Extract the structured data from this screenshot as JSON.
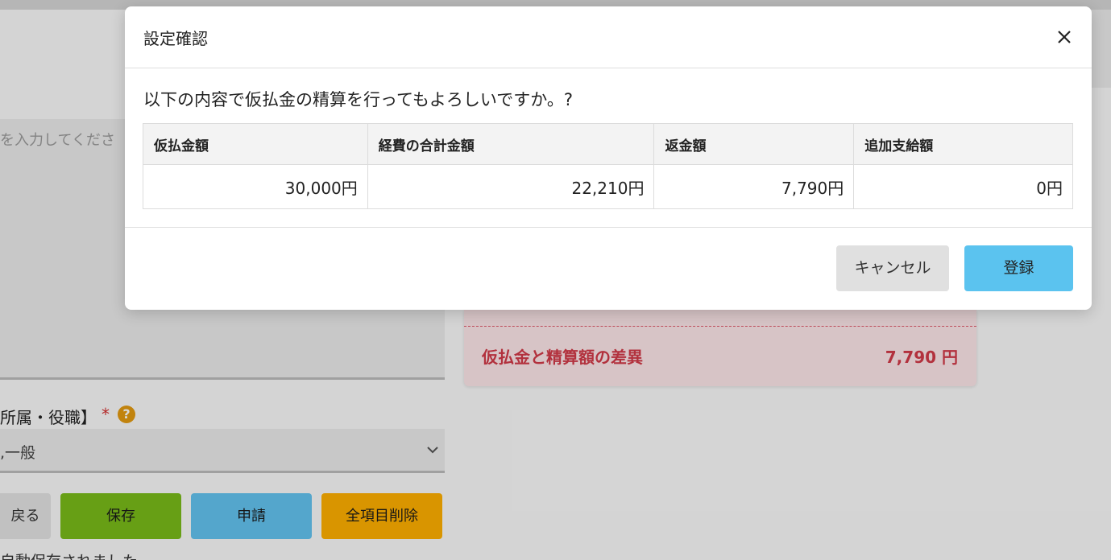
{
  "background": {
    "textarea_placeholder": "を入力してくださ",
    "field_label": "所属・役職】",
    "required_mark": "*",
    "help_icon_glyph": "?",
    "select_value": ",一般",
    "buttons": {
      "back": "戻る",
      "save": "保存",
      "apply": "申請",
      "clear_all": "全項目削除"
    },
    "autosave_text": "自動保存されました",
    "summary": {
      "label": "仮払金と精算額の差異",
      "value": "7,790 円"
    }
  },
  "modal": {
    "title": "設定確認",
    "close_icon": "close-icon",
    "message": "以下の内容で仮払金の精算を行ってもよろしいですか。?",
    "table": {
      "headers": [
        "仮払金額",
        "経費の合計金額",
        "返金額",
        "追加支給額"
      ],
      "values": [
        "30,000円",
        "22,210円",
        "7,790円",
        "0円"
      ]
    },
    "cancel_label": "キャンセル",
    "confirm_label": "登録"
  },
  "colors": {
    "save": "#79bb19",
    "apply": "#63c3f0",
    "clear": "#ffb000",
    "confirm": "#5bc3ef",
    "danger_text": "#d23a48"
  }
}
